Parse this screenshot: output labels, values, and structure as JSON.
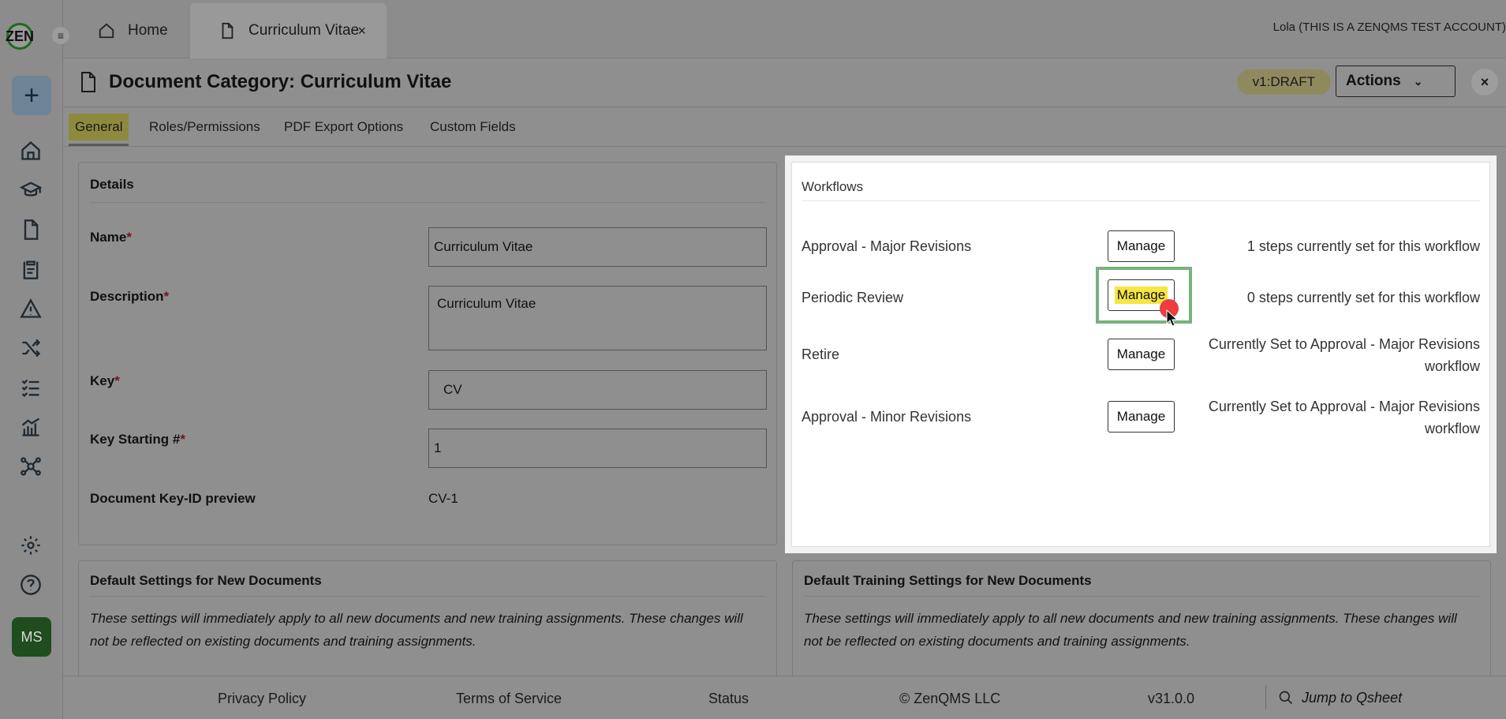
{
  "app": {
    "logo_text": "ZEN",
    "account": "Lola (THIS IS A ZENQMS TEST ACCOUNT)",
    "avatar_initials": "MS"
  },
  "tabs": [
    {
      "label": "Home",
      "icon": "home-icon"
    },
    {
      "label": "Curriculum Vitae",
      "icon": "document-icon",
      "active": true,
      "close": "×"
    }
  ],
  "header": {
    "title": "Document Category: Curriculum Vitae",
    "status": "v1:DRAFT",
    "actions_label": "Actions",
    "close": "×"
  },
  "subtabs": [
    "General",
    "Roles/Permissions",
    "PDF Export Options",
    "Custom Fields"
  ],
  "details": {
    "title": "Details",
    "name_label": "Name",
    "name_value": "Curriculum Vitae",
    "description_label": "Description",
    "description_value": "Curriculum Vitae",
    "key_label": "Key",
    "key_value": "CV",
    "key_start_label": "Key Starting #",
    "key_start_value": "1",
    "preview_label": "Document Key-ID preview",
    "preview_value": "CV-1",
    "required_mark": "*"
  },
  "workflows": {
    "title": "Workflows",
    "manage_label": "Manage",
    "rows": [
      {
        "name": "Approval - Major Revisions",
        "status": "1 steps currently set for this workflow"
      },
      {
        "name": "Periodic Review",
        "status": "0 steps currently set for this workflow"
      },
      {
        "name": "Retire",
        "status": "Currently Set to Approval - Major Revisions workflow"
      },
      {
        "name": "Approval - Minor Revisions",
        "status": "Currently Set to Approval - Major Revisions workflow"
      }
    ]
  },
  "default_settings": {
    "title": "Default Settings for New Documents",
    "note": "These settings will immediately apply to all new documents and new training assignments. These changes will not be reflected on existing documents and training assignments."
  },
  "training_settings": {
    "title": "Default Training Settings for New Documents",
    "note": "These settings will immediately apply to all new documents and new training assignments. These changes will not be reflected on existing documents and training assignments."
  },
  "footer": {
    "privacy": "Privacy Policy",
    "terms": "Terms of Service",
    "status": "Status",
    "copyright": "© ZenQMS LLC",
    "version": "v31.0.0",
    "jump_placeholder": "Jump to Qsheet"
  },
  "colors": {
    "highlight": "#f5e642",
    "focus_border": "#77b27c",
    "click_marker": "#ee3d3d"
  }
}
